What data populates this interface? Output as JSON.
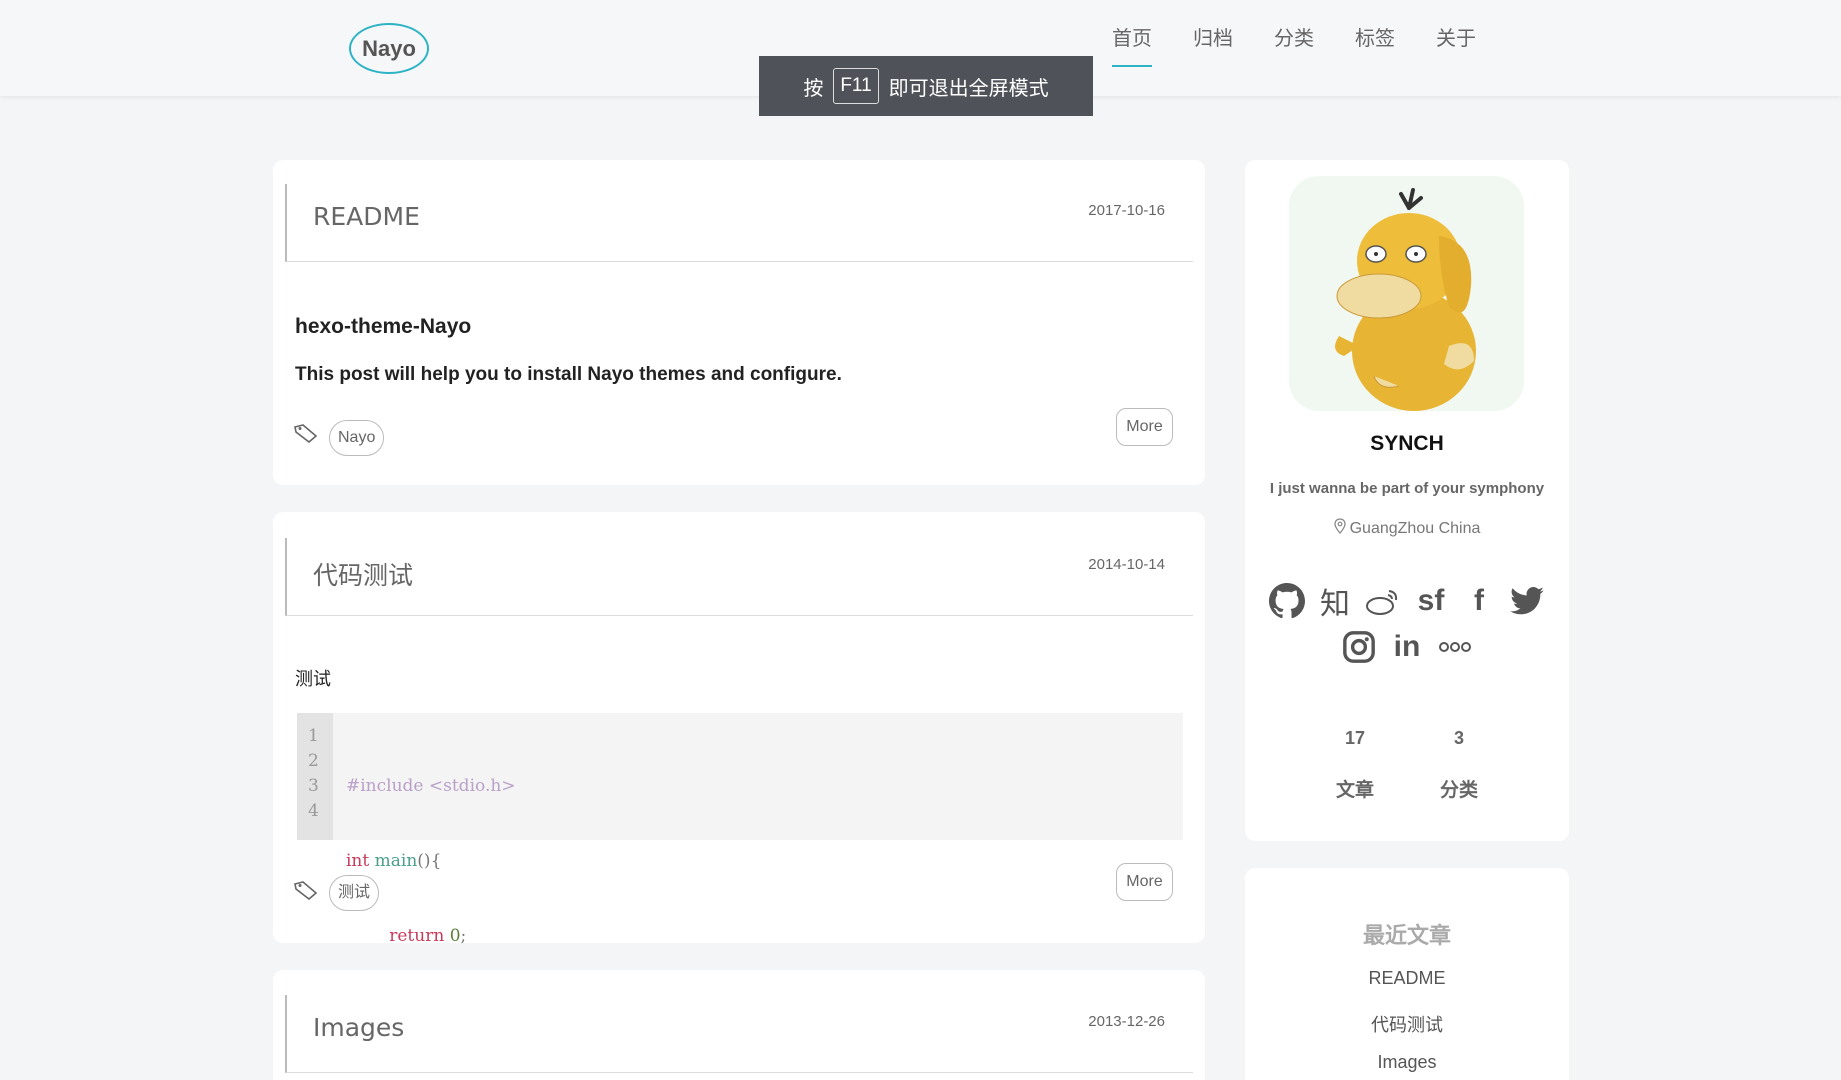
{
  "header": {
    "logo": "Nayo",
    "nav": [
      "首页",
      "归档",
      "分类",
      "标签",
      "关于"
    ]
  },
  "toast": {
    "prefix": "按",
    "key": "F11",
    "suffix": "即可退出全屏模式"
  },
  "posts": [
    {
      "title": "README",
      "date": "2017-10-16",
      "heading": "hexo-theme-Nayo",
      "excerpt": "This post will help you to install Nayo themes and configure.",
      "tag": "Nayo",
      "more": "More"
    },
    {
      "title": "代码测试",
      "date": "2014-10-14",
      "excerpt": "测试",
      "code": {
        "line_numbers": [
          "1",
          "2",
          "3",
          "4"
        ],
        "lines": [
          "#include <stdio.h>",
          "int main(){",
          "        return 0;",
          "}"
        ]
      },
      "tag": "测试",
      "more": "More"
    },
    {
      "title": "Images",
      "date": "2013-12-26"
    }
  ],
  "profile": {
    "name": "SYNCH",
    "motto": "I just wanna be part of your symphony",
    "location": "GuangZhou China",
    "social_icons": [
      "github-icon",
      "zhihu-icon",
      "weibo-icon",
      "segmentfault-icon",
      "facebook-icon",
      "twitter-icon",
      "instagram-icon",
      "linkedin-icon",
      "flickr-icon"
    ],
    "social_text": {
      "zhihu": "知",
      "sf": "sf",
      "facebook": "f",
      "linkedin": "in"
    },
    "stats": [
      {
        "num": "17",
        "label": "文章"
      },
      {
        "num": "3",
        "label": "分类"
      }
    ]
  },
  "recent": {
    "title": "最近文章",
    "items": [
      "README",
      "代码测试",
      "Images"
    ]
  },
  "colors": {
    "accent": "#2cb3c4",
    "background": "#f4f5f7",
    "card": "#ffffff"
  }
}
